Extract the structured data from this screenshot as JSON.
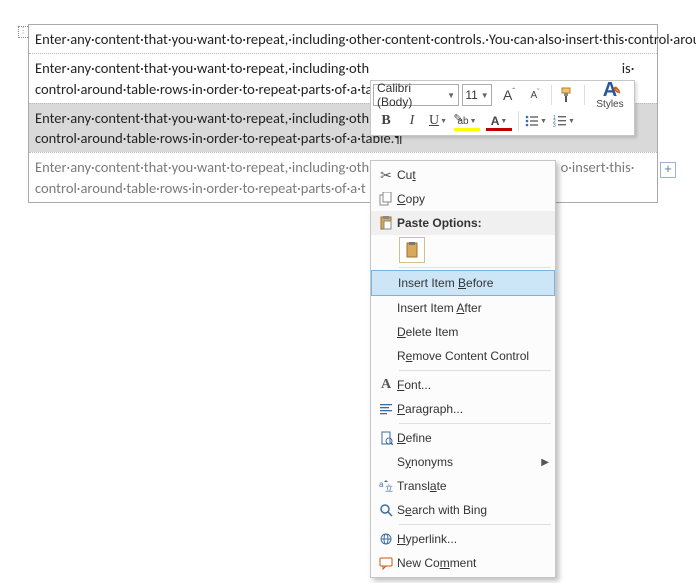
{
  "doc": {
    "rows": [
      "Enter·any·content·that·you·want·to·repeat,·including·other·content·controls.·You·can·also·insert·this·control·around·table·rows·in·order·to·repeat·parts·of·a·table.¶",
      "Enter·any·content·that·you·want·to·repeat,·including·other·content·controls.·You·can·also·insert·this·control·around·table·rows·in·order·to·repeat·parts·of·a·table.¶",
      "Enter·any·content·that·you·want·to·repeat,·including·other·content·controls.·You·can·also·insert·this·control·around·table·rows·in·order·to·repeat·parts·of·a·table.¶",
      "Enter·any·content·that·you·want·to·repeat,·including·other·content·controls.·You·can·also·insert·this·control·around·table·rows·in·order·to·repeat·parts·of·a·table.¶"
    ],
    "truncated_left": "Enter·any·content·that·you·want·to·repeat,·including·oth",
    "truncated_right_a": "is·",
    "truncated_right_b": "s·",
    "truncated_right_c": "o·insert·this·",
    "row2b_left": "control·around·table·rows·in·order·to·repeat·parts·of·a·ta",
    "row2b_leftb": "control·around·table·rows·in·order·to·repeat·parts·of·a·ta",
    "row2b_leftc": "control·around·table·rows·in·order·to·repeat·parts·of·a·t",
    "row3b_left": "control·around·table·rows·in·order·to·repeat·parts·of·a·table.¶"
  },
  "toolbar": {
    "font_name": "Calibri (Body)",
    "font_size": "11",
    "styles_label": "Styles",
    "bold": "B",
    "italic": "I",
    "underline": "U",
    "grow": "A",
    "shrink": "A",
    "highlight": "ab",
    "fontcolor": "A"
  },
  "menu": {
    "cut": "Cut",
    "copy": "Copy",
    "paste_options": "Paste Options:",
    "insert_before": "Insert Item Before",
    "insert_after": "Insert Item After",
    "delete_item": "Delete Item",
    "remove_cc": "Remove Content Control",
    "font": "Font...",
    "paragraph": "Paragraph...",
    "define": "Define",
    "synonyms": "Synonyms",
    "translate": "Translate",
    "search_bing": "Search with Bing",
    "hyperlink": "Hyperlink...",
    "new_comment": "New Comment"
  },
  "letters": {
    "t": "t",
    "C": "C",
    "B": "B",
    "A": "A",
    "D": "D",
    "F": "F",
    "P": "P",
    "e": "e",
    "y": "y",
    "a": "a",
    "S": "S",
    "H": "H",
    "m": "m",
    "o": "o",
    "l": "l"
  }
}
